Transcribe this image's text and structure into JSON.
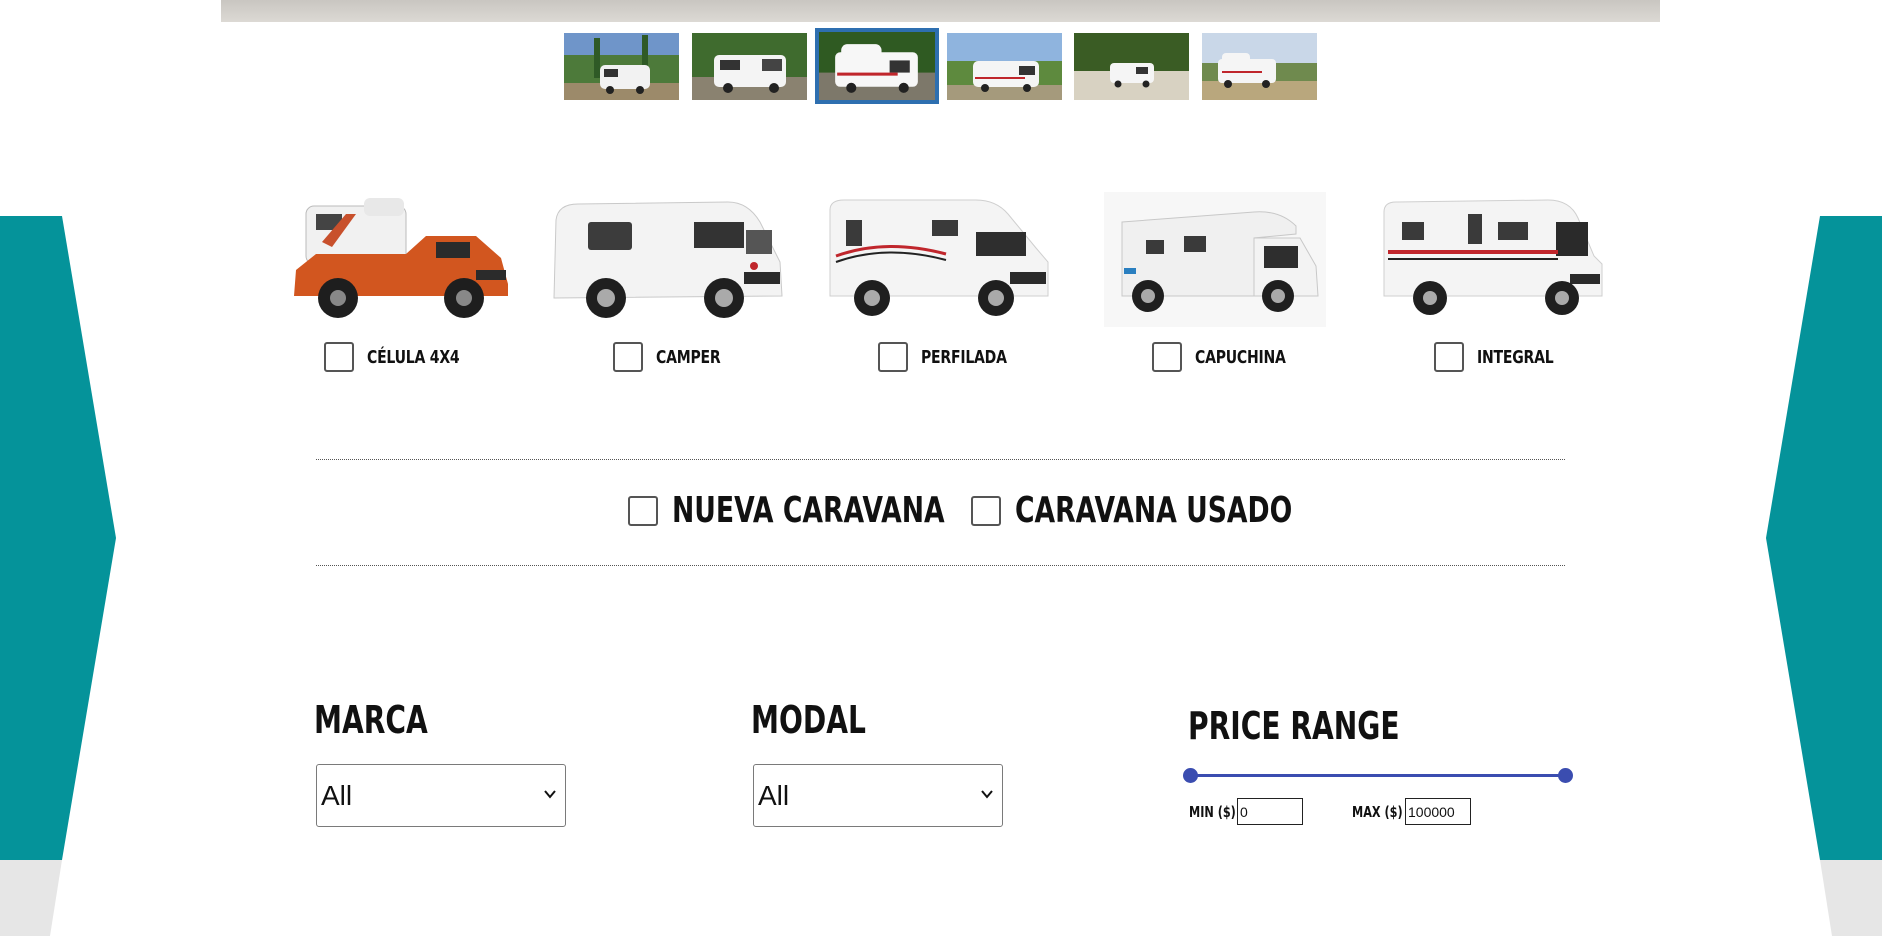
{
  "gallery": {
    "thumbnails": [
      {
        "name": "thumb-1",
        "active": false
      },
      {
        "name": "thumb-2",
        "active": false
      },
      {
        "name": "thumb-3",
        "active": true
      },
      {
        "name": "thumb-4",
        "active": false
      },
      {
        "name": "thumb-5",
        "active": false
      },
      {
        "name": "thumb-6",
        "active": false
      }
    ]
  },
  "vehicle_types": [
    {
      "label": "CÉLULA 4X4",
      "checked": false,
      "image": "pickup-truck-camper"
    },
    {
      "label": "CAMPER",
      "checked": false,
      "image": "camper-van"
    },
    {
      "label": "PERFILADA",
      "checked": false,
      "image": "low-profile-motorhome"
    },
    {
      "label": "CAPUCHINA",
      "checked": false,
      "image": "overcab-motorhome"
    },
    {
      "label": "INTEGRAL",
      "checked": false,
      "image": "integrated-motorhome"
    }
  ],
  "condition": {
    "new_label": "NUEVA CARAVANA",
    "used_label": "CARAVANA USADO"
  },
  "filters": {
    "brand": {
      "title": "MARCA",
      "selected": "All"
    },
    "model": {
      "title": "MODAL",
      "selected": "All"
    },
    "price": {
      "title": "PRICE RANGE",
      "min_label": "MIN ($)",
      "max_label": "MAX ($)",
      "min_value": "0",
      "max_value": "100000"
    }
  },
  "colors": {
    "accent_teal": "#05939a",
    "slider_blue": "#3b4db0",
    "active_thumb_border": "#2e6fb0"
  }
}
